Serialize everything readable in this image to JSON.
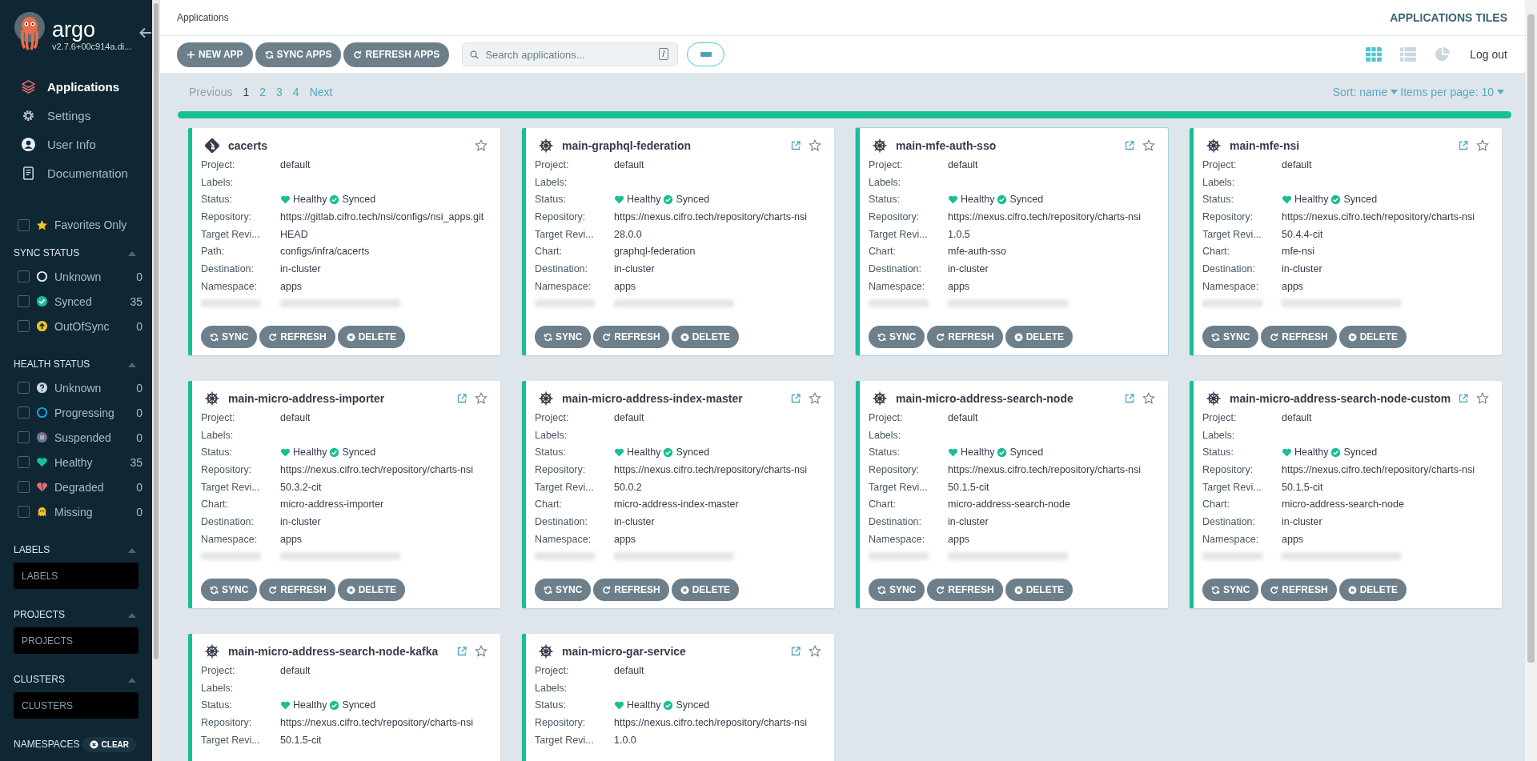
{
  "sidebar": {
    "brand": "argo",
    "version": "v2.7.6+00c914a.di...",
    "nav": [
      {
        "label": "Applications",
        "selected": true
      },
      {
        "label": "Settings",
        "selected": false
      },
      {
        "label": "User Info",
        "selected": false
      },
      {
        "label": "Documentation",
        "selected": false
      }
    ],
    "favorites": {
      "label": "Favorites Only",
      "checked": false
    },
    "sync_status": {
      "title": "SYNC STATUS",
      "expanded": true,
      "items": [
        {
          "label": "Unknown",
          "count": "0",
          "checked": false
        },
        {
          "label": "Synced",
          "count": "35",
          "checked": false
        },
        {
          "label": "OutOfSync",
          "count": "0",
          "checked": false
        }
      ]
    },
    "health_status": {
      "title": "HEALTH STATUS",
      "expanded": true,
      "items": [
        {
          "label": "Unknown",
          "count": "0",
          "checked": false
        },
        {
          "label": "Progressing",
          "count": "0",
          "checked": false
        },
        {
          "label": "Suspended",
          "count": "0",
          "checked": false
        },
        {
          "label": "Healthy",
          "count": "35",
          "checked": false
        },
        {
          "label": "Degraded",
          "count": "0",
          "checked": false
        },
        {
          "label": "Missing",
          "count": "0",
          "checked": false
        }
      ]
    },
    "filters": [
      {
        "title": "LABELS",
        "expanded": true,
        "placeholder": "LABELS"
      },
      {
        "title": "PROJECTS",
        "expanded": true,
        "placeholder": "PROJECTS"
      },
      {
        "title": "CLUSTERS",
        "expanded": true,
        "placeholder": "CLUSTERS"
      }
    ],
    "namespaces": {
      "title": "NAMESPACES",
      "clear": "CLEAR"
    }
  },
  "top_bar": {
    "breadcrumb": "Applications",
    "view_title": "APPLICATIONS TILES"
  },
  "toolbar": {
    "buttons": [
      "NEW APP",
      "SYNC APPS",
      "REFRESH APPS"
    ],
    "search": {
      "placeholder": "Search applications...",
      "shortcut": "/"
    },
    "views": [
      {
        "selected": true
      },
      {
        "selected": false
      },
      {
        "selected": false
      }
    ],
    "logout": "Log out"
  },
  "pagination": {
    "previous": "Previous",
    "pages": [
      {
        "label": "1",
        "selected": true
      },
      {
        "label": "2",
        "selected": false
      },
      {
        "label": "3",
        "selected": false
      },
      {
        "label": "4",
        "selected": false
      }
    ],
    "next": "Next",
    "sort": "Sort: name",
    "per_page": "Items per page: 10"
  },
  "cards": [
    {
      "kind": "git",
      "title": "cacerts",
      "external_link": false,
      "starred": false,
      "fields": [
        {
          "kind": "text",
          "label": "Project:",
          "value": "default"
        },
        {
          "kind": "text",
          "label": "Labels:"
        },
        {
          "kind": "status",
          "label": "Status:",
          "health": "Healthy",
          "sync": "Synced"
        },
        {
          "kind": "text",
          "label": "Repository:",
          "value": "https://gitlab.cifro.tech/nsi/configs/nsi_apps.git"
        },
        {
          "kind": "text",
          "label": "Target Revi...",
          "value": "HEAD"
        },
        {
          "kind": "text",
          "label": "Path:",
          "value": "configs/infra/cacerts"
        },
        {
          "kind": "text",
          "label": "Destination:",
          "value": "in-cluster"
        },
        {
          "kind": "text",
          "label": "Namespace:",
          "value": "apps"
        },
        {
          "kind": "blurred"
        }
      ],
      "buttons": [
        "SYNC",
        "REFRESH",
        "DELETE"
      ]
    },
    {
      "kind": "helm",
      "title": "main-graphql-federation",
      "external_link": true,
      "starred": false,
      "fields": [
        {
          "kind": "text",
          "label": "Project:",
          "value": "default"
        },
        {
          "kind": "text",
          "label": "Labels:"
        },
        {
          "kind": "status",
          "label": "Status:",
          "health": "Healthy",
          "sync": "Synced"
        },
        {
          "kind": "text",
          "label": "Repository:",
          "value": "https://nexus.cifro.tech/repository/charts-nsi"
        },
        {
          "kind": "text",
          "label": "Target Revi...",
          "value": "28.0.0"
        },
        {
          "kind": "text",
          "label": "Chart:",
          "value": "graphql-federation"
        },
        {
          "kind": "text",
          "label": "Destination:",
          "value": "in-cluster"
        },
        {
          "kind": "text",
          "label": "Namespace:",
          "value": "apps"
        },
        {
          "kind": "blurred"
        }
      ],
      "buttons": [
        "SYNC",
        "REFRESH",
        "DELETE"
      ]
    },
    {
      "kind": "helm",
      "title": "main-mfe-auth-sso",
      "external_link": true,
      "starred": false,
      "fields": [
        {
          "kind": "text",
          "label": "Project:",
          "value": "default"
        },
        {
          "kind": "text",
          "label": "Labels:"
        },
        {
          "kind": "status",
          "label": "Status:",
          "health": "Healthy",
          "sync": "Synced"
        },
        {
          "kind": "text",
          "label": "Repository:",
          "value": "https://nexus.cifro.tech/repository/charts-nsi"
        },
        {
          "kind": "text",
          "label": "Target Revi...",
          "value": "1.0.5"
        },
        {
          "kind": "text",
          "label": "Chart:",
          "value": "mfe-auth-sso"
        },
        {
          "kind": "text",
          "label": "Destination:",
          "value": "in-cluster"
        },
        {
          "kind": "text",
          "label": "Namespace:",
          "value": "apps"
        },
        {
          "kind": "blurred"
        }
      ],
      "buttons": [
        "SYNC",
        "REFRESH",
        "DELETE"
      ]
    },
    {
      "kind": "helm",
      "title": "main-mfe-nsi",
      "external_link": true,
      "starred": false,
      "fields": [
        {
          "kind": "text",
          "label": "Project:",
          "value": "default"
        },
        {
          "kind": "text",
          "label": "Labels:"
        },
        {
          "kind": "status",
          "label": "Status:",
          "health": "Healthy",
          "sync": "Synced"
        },
        {
          "kind": "text",
          "label": "Repository:",
          "value": "https://nexus.cifro.tech/repository/charts-nsi"
        },
        {
          "kind": "text",
          "label": "Target Revi...",
          "value": "50.4.4-cit"
        },
        {
          "kind": "text",
          "label": "Chart:",
          "value": "mfe-nsi"
        },
        {
          "kind": "text",
          "label": "Destination:",
          "value": "in-cluster"
        },
        {
          "kind": "text",
          "label": "Namespace:",
          "value": "apps"
        },
        {
          "kind": "blurred"
        }
      ],
      "buttons": [
        "SYNC",
        "REFRESH",
        "DELETE"
      ]
    },
    {
      "kind": "helm",
      "title": "main-micro-address-importer",
      "external_link": true,
      "starred": false,
      "fields": [
        {
          "kind": "text",
          "label": "Project:",
          "value": "default"
        },
        {
          "kind": "text",
          "label": "Labels:"
        },
        {
          "kind": "status",
          "label": "Status:",
          "health": "Healthy",
          "sync": "Synced"
        },
        {
          "kind": "text",
          "label": "Repository:",
          "value": "https://nexus.cifro.tech/repository/charts-nsi"
        },
        {
          "kind": "text",
          "label": "Target Revi...",
          "value": "50.3.2-cit"
        },
        {
          "kind": "text",
          "label": "Chart:",
          "value": "micro-address-importer"
        },
        {
          "kind": "text",
          "label": "Destination:",
          "value": "in-cluster"
        },
        {
          "kind": "text",
          "label": "Namespace:",
          "value": "apps"
        },
        {
          "kind": "blurred"
        }
      ],
      "buttons": [
        "SYNC",
        "REFRESH",
        "DELETE"
      ]
    },
    {
      "kind": "helm",
      "title": "main-micro-address-index-master",
      "external_link": true,
      "starred": false,
      "fields": [
        {
          "kind": "text",
          "label": "Project:",
          "value": "default"
        },
        {
          "kind": "text",
          "label": "Labels:"
        },
        {
          "kind": "status",
          "label": "Status:",
          "health": "Healthy",
          "sync": "Synced"
        },
        {
          "kind": "text",
          "label": "Repository:",
          "value": "https://nexus.cifro.tech/repository/charts-nsi"
        },
        {
          "kind": "text",
          "label": "Target Revi...",
          "value": "50.0.2"
        },
        {
          "kind": "text",
          "label": "Chart:",
          "value": "micro-address-index-master"
        },
        {
          "kind": "text",
          "label": "Destination:",
          "value": "in-cluster"
        },
        {
          "kind": "text",
          "label": "Namespace:",
          "value": "apps"
        },
        {
          "kind": "blurred"
        }
      ],
      "buttons": [
        "SYNC",
        "REFRESH",
        "DELETE"
      ]
    },
    {
      "kind": "helm",
      "title": "main-micro-address-search-node",
      "external_link": true,
      "starred": false,
      "fields": [
        {
          "kind": "text",
          "label": "Project:",
          "value": "default"
        },
        {
          "kind": "text",
          "label": "Labels:"
        },
        {
          "kind": "status",
          "label": "Status:",
          "health": "Healthy",
          "sync": "Synced"
        },
        {
          "kind": "text",
          "label": "Repository:",
          "value": "https://nexus.cifro.tech/repository/charts-nsi"
        },
        {
          "kind": "text",
          "label": "Target Revi...",
          "value": "50.1.5-cit"
        },
        {
          "kind": "text",
          "label": "Chart:",
          "value": "micro-address-search-node"
        },
        {
          "kind": "text",
          "label": "Destination:",
          "value": "in-cluster"
        },
        {
          "kind": "text",
          "label": "Namespace:",
          "value": "apps"
        },
        {
          "kind": "blurred"
        }
      ],
      "buttons": [
        "SYNC",
        "REFRESH",
        "DELETE"
      ]
    },
    {
      "kind": "helm",
      "title": "main-micro-address-search-node-custom",
      "external_link": true,
      "starred": false,
      "fields": [
        {
          "kind": "text",
          "label": "Project:",
          "value": "default"
        },
        {
          "kind": "text",
          "label": "Labels:"
        },
        {
          "kind": "status",
          "label": "Status:",
          "health": "Healthy",
          "sync": "Synced"
        },
        {
          "kind": "text",
          "label": "Repository:",
          "value": "https://nexus.cifro.tech/repository/charts-nsi"
        },
        {
          "kind": "text",
          "label": "Target Revi...",
          "value": "50.1.5-cit"
        },
        {
          "kind": "text",
          "label": "Chart:",
          "value": "micro-address-search-node"
        },
        {
          "kind": "text",
          "label": "Destination:",
          "value": "in-cluster"
        },
        {
          "kind": "text",
          "label": "Namespace:",
          "value": "apps"
        },
        {
          "kind": "blurred"
        }
      ],
      "buttons": [
        "SYNC",
        "REFRESH",
        "DELETE"
      ]
    },
    {
      "kind": "helm",
      "title": "main-micro-address-search-node-kafka",
      "external_link": true,
      "starred": false,
      "fields": [
        {
          "kind": "text",
          "label": "Project:",
          "value": "default"
        },
        {
          "kind": "text",
          "label": "Labels:"
        },
        {
          "kind": "status",
          "label": "Status:",
          "health": "Healthy",
          "sync": "Synced"
        },
        {
          "kind": "text",
          "label": "Repository:",
          "value": "https://nexus.cifro.tech/repository/charts-nsi"
        },
        {
          "kind": "text",
          "label": "Target Revi...",
          "value": "50.1.5-cit"
        }
      ]
    },
    {
      "kind": "helm",
      "title": "main-micro-gar-service",
      "external_link": true,
      "starred": false,
      "fields": [
        {
          "kind": "text",
          "label": "Project:",
          "value": "default"
        },
        {
          "kind": "text",
          "label": "Labels:"
        },
        {
          "kind": "status",
          "label": "Status:",
          "health": "Healthy",
          "sync": "Synced"
        },
        {
          "kind": "text",
          "label": "Repository:",
          "value": "https://nexus.cifro.tech/repository/charts-nsi"
        },
        {
          "kind": "text",
          "label": "Target Revi...",
          "value": "1.0.0"
        }
      ]
    }
  ]
}
